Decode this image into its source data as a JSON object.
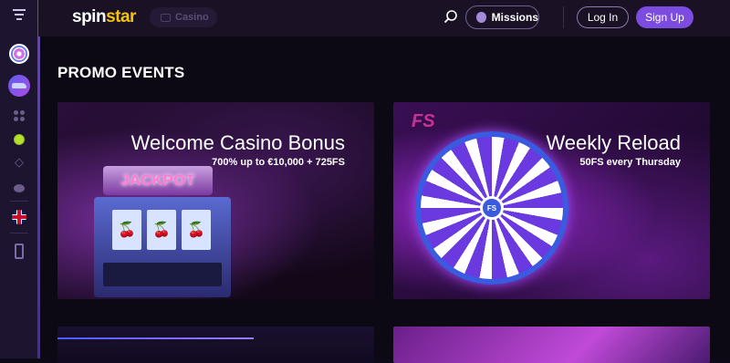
{
  "header": {
    "logo_spin": "spin",
    "logo_star": "star",
    "casino_label": "Casino",
    "missions_label": "Missions",
    "login_label": "Log In",
    "signup_label": "Sign Up"
  },
  "sidebar": {
    "items": [
      {
        "icon": "hamburger-menu-icon"
      },
      {
        "icon": "wheel-icon"
      },
      {
        "icon": "car-icon"
      },
      {
        "icon": "dots-grid-icon"
      },
      {
        "icon": "tennis-ball-icon"
      },
      {
        "icon": "diamond-icon"
      },
      {
        "icon": "chat-icon"
      },
      {
        "icon": "uk-flag-icon"
      },
      {
        "icon": "mobile-app-icon"
      }
    ]
  },
  "main": {
    "title_bold": "PROMO",
    "title_rest": "EVENTS",
    "promos": [
      {
        "title": "Welcome Casino Bonus",
        "subtitle": "700% up to €10,000 + 725FS",
        "art_text": "JACKPOT"
      },
      {
        "title": "Weekly Reload",
        "subtitle": "50FS every Thursday",
        "art_text": "FS"
      }
    ]
  },
  "colors": {
    "accent": "#7c4ce0",
    "logo_star": "#f6c20e",
    "background": "#0c0814"
  }
}
